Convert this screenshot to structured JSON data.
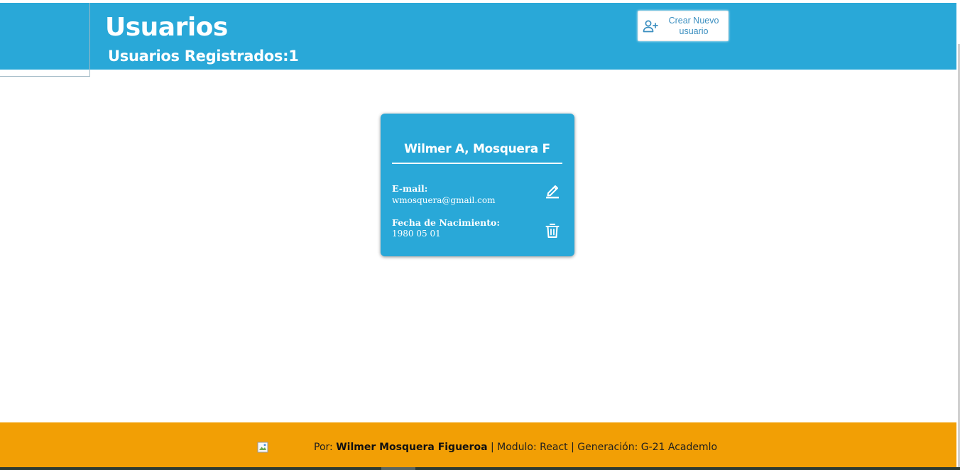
{
  "header": {
    "title": "Usuarios",
    "registered_label": "Usuarios Registrados:",
    "registered_count": "1",
    "create_button_label": "Crear Nuevo usuario",
    "create_button_icon": "add-user-icon"
  },
  "colors": {
    "primary": "#29a8d8",
    "footer": "#f29f05",
    "button_text": "#3b8fc0"
  },
  "users": [
    {
      "name": "Wilmer A, Mosquera F",
      "email_label": "E-mail:",
      "email": "wmosquera@gmail.com",
      "birth_label": "Fecha de Nacimiento:",
      "birth_date": "1980 05 01",
      "edit_icon": "pencil-icon",
      "delete_icon": "trash-icon"
    }
  ],
  "footer": {
    "prefix": "Por:",
    "author": "Wilmer Mosquera Figueroa",
    "rest": "| Modulo: React | Generación: G-21 Academlo"
  }
}
